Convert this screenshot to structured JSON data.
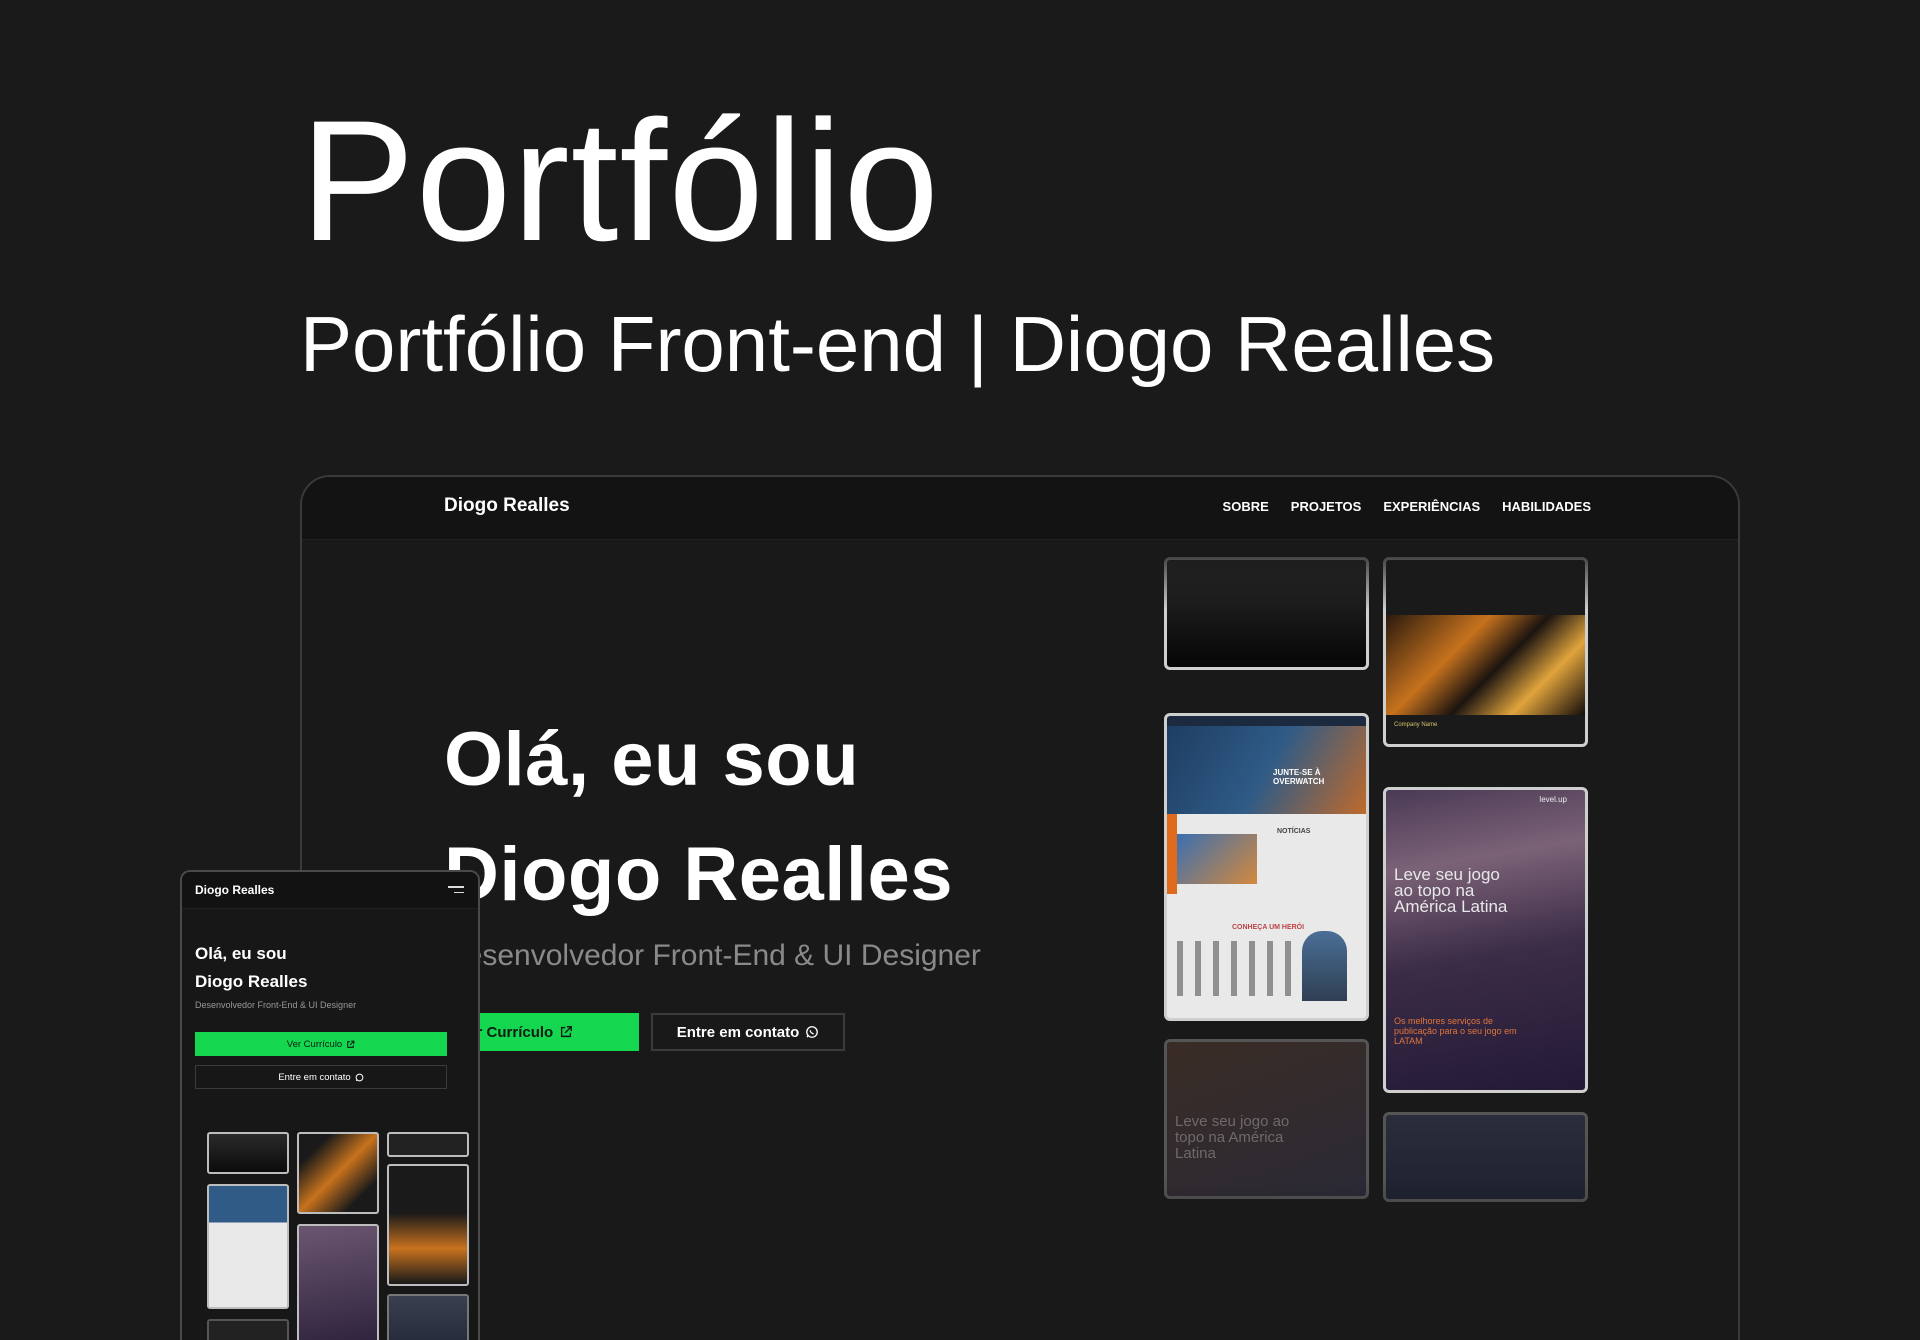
{
  "header": {
    "title": "Portfólio",
    "subtitle": "Portfólio Front-end | Diogo Realles"
  },
  "desktop": {
    "nav": {
      "logo": "Diogo Realles",
      "links": [
        "SOBRE",
        "PROJETOS",
        "EXPERIÊNCIAS",
        "HABILIDADES"
      ]
    },
    "hero": {
      "line1": "Olá, eu sou",
      "line2": "Diogo Realles",
      "subtitle": "Desenvolvedor Front-End & UI Designer",
      "cta_primary": "Ver Currículo",
      "cta_secondary": "Entre em contato"
    },
    "cards": {
      "levelup_heading": "Leve seu jogo ao topo na América Latina",
      "levelup_sub": "Os melhores serviços de publicação para o seu jogo em LATAM",
      "levelup_logo": "level.up",
      "news_heading": "NOTÍCIAS",
      "heroes_heading": "CONHEÇA UM HERÓI",
      "join_heading": "JUNTE-SE À OVERWATCH",
      "company": "Company Name"
    }
  },
  "mobile": {
    "nav": {
      "logo": "Diogo Realles"
    },
    "hero": {
      "line1": "Olá, eu sou",
      "line2": "Diogo Realles",
      "subtitle": "Desenvolvedor Front-End & UI Designer",
      "cta_primary": "Ver Currículo",
      "cta_secondary": "Entre em contato"
    }
  },
  "colors": {
    "background": "#1a1a1a",
    "accent_green": "#14d74f",
    "text": "#ffffff",
    "muted": "#8a8a8a"
  },
  "icons": {
    "external_link": "external-link-icon",
    "whatsapp": "whatsapp-icon",
    "menu": "hamburger-menu-icon"
  }
}
